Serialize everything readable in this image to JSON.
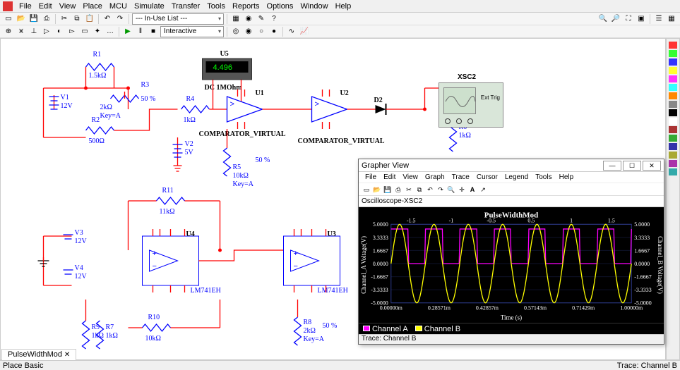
{
  "main_menu": [
    "File",
    "Edit",
    "View",
    "Place",
    "MCU",
    "Simulate",
    "Transfer",
    "Tools",
    "Reports",
    "Options",
    "Window",
    "Help"
  ],
  "toolbar2_combo": "--- In-Use List ---",
  "toolbar3_combo": "Interactive",
  "status_left": "Place Basic",
  "status_right": "Trace: Channel B",
  "tab_name": "PulseWidthMod",
  "scope": {
    "ref": "XSC2",
    "ext": "Ext Trig"
  },
  "meter": {
    "ref": "U5",
    "reading": "4.496",
    "mode": "DC  1MOhm"
  },
  "components": {
    "V1": {
      "ref": "V1",
      "val": "12V"
    },
    "V2": {
      "ref": "V2",
      "val": "5V"
    },
    "V3": {
      "ref": "V3",
      "val": "12V"
    },
    "V4": {
      "ref": "V4",
      "val": "12V"
    },
    "R1": {
      "ref": "R1",
      "val": "1.5kΩ"
    },
    "R2": {
      "ref": "R2",
      "val": "500Ω"
    },
    "R3": {
      "ref": "R3",
      "val": "2kΩ",
      "pct": "50 %",
      "key": "Key=A"
    },
    "R4": {
      "ref": "R4",
      "val": "1kΩ"
    },
    "R5": {
      "ref": "R5",
      "val": "10kΩ",
      "pct": "50 %",
      "key": "Key=A"
    },
    "R6": {
      "ref": "R6",
      "val": "1kΩ"
    },
    "R7": {
      "ref": "R7",
      "val": "1kΩ"
    },
    "R8": {
      "ref": "R8",
      "val": "2kΩ",
      "pct": "50 %",
      "key": "Key=A"
    },
    "R9": {
      "ref": "R9",
      "val": "1kΩ"
    },
    "R10": {
      "ref": "R10",
      "val": "10kΩ"
    },
    "R11": {
      "ref": "R11",
      "val": "11kΩ"
    },
    "U1": {
      "ref": "U1",
      "part": "COMPARATOR_VIRTUAL"
    },
    "U2": {
      "ref": "U2",
      "part": "COMPARATOR_VIRTUAL"
    },
    "U3": {
      "ref": "U3",
      "part": "LM741EH"
    },
    "U4": {
      "ref": "U4",
      "part": "LM741EH"
    },
    "D2": {
      "ref": "D2"
    }
  },
  "grapher": {
    "title": "Grapher View",
    "menu": [
      "File",
      "Edit",
      "View",
      "Graph",
      "Trace",
      "Cursor",
      "Legend",
      "Tools",
      "Help"
    ],
    "tab": "Oscilloscope-XSC2",
    "plot_title": "PulseWidthMod",
    "xlabel": "Time (s)",
    "ylabel_left": "Channel_A Voltage(V)",
    "ylabel_right": "Channel_B Voltage(V)",
    "legend": {
      "a": "Channel A",
      "b": "Channel B"
    },
    "status": "Trace: Channel B"
  },
  "chart_data": {
    "type": "line",
    "title": "PulseWidthMod",
    "xlabel": "Time (s)",
    "ylabel": "Voltage (V)",
    "x_ticks_top": [
      -1.5,
      -1.0,
      -0.5,
      0.5,
      1.0,
      1.5
    ],
    "x_ticks_bottom": [
      "0.00000m",
      "0.28571m",
      "0.42857m",
      "0.57143m",
      "0.71429m",
      "1.00000m"
    ],
    "y_ticks_left": [
      -5.0,
      -3.3333,
      -1.6667,
      0.0,
      1.6667,
      3.3333,
      5.0
    ],
    "y_ticks_right": [
      -5.0,
      -3.3333,
      -1.6667,
      0.0,
      1.6667,
      3.3333,
      5.0
    ],
    "ylim": [
      -5,
      5
    ],
    "xlim_ms": [
      0,
      1.0
    ],
    "series": [
      {
        "name": "Channel A",
        "color": "#ff00ff",
        "type": "square",
        "period_ms": 0.142857,
        "high": 4.4,
        "low": 0.0,
        "duty": 0.5
      },
      {
        "name": "Channel B",
        "color": "#ffff00",
        "type": "sine",
        "period_ms": 0.142857,
        "amplitude": 5.0,
        "offset": 0.0
      }
    ]
  },
  "colors": {
    "wire": "#ff0000",
    "component": "#0000ff",
    "scope_bg": "#d9e6d9",
    "plot_bg": "#000000",
    "grid": "#2d3a8a"
  },
  "rail_swatches": [
    "#f33",
    "#3f3",
    "#33f",
    "#ff3",
    "#f3f",
    "#3ff",
    "#f80",
    "#888",
    "#000",
    "#fff",
    "#a33",
    "#3a3",
    "#33a",
    "#aa3",
    "#a3a",
    "#3aa"
  ]
}
